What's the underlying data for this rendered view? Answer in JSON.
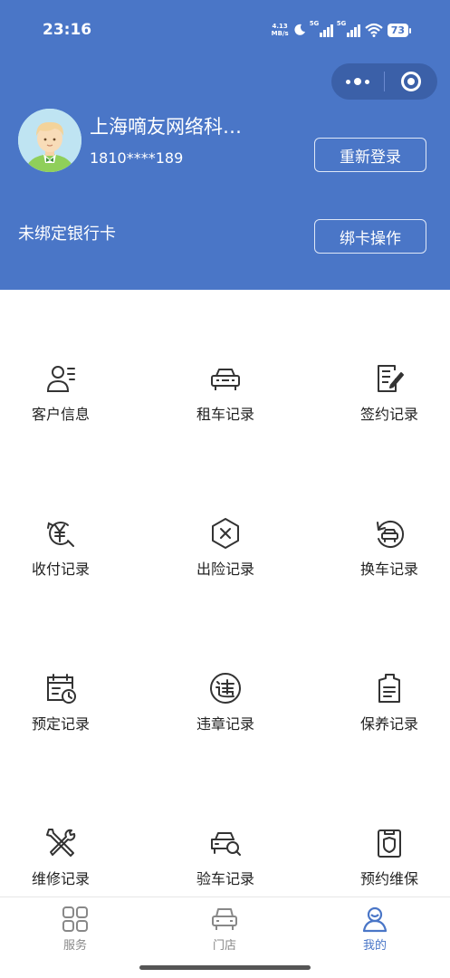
{
  "status_bar": {
    "time": "23:16",
    "net_speed_value": "4.13",
    "net_speed_unit": "MB/s",
    "signal_1": "5G",
    "signal_2": "5G",
    "battery": "73"
  },
  "capsule_icons": [
    "more-dots-icon",
    "close-target-icon"
  ],
  "profile": {
    "name": "上海嘀友网络科…",
    "phone": "1810****189",
    "relogin_label": "重新登录",
    "bank_status": "未绑定银行卡",
    "bind_card_label": "绑卡操作"
  },
  "menu": [
    {
      "label": "客户信息",
      "icon": "customer-info-icon"
    },
    {
      "label": "租车记录",
      "icon": "rental-car-icon"
    },
    {
      "label": "签约记录",
      "icon": "contract-icon"
    },
    {
      "label": "收付记录",
      "icon": "payment-icon"
    },
    {
      "label": "出险记录",
      "icon": "accident-icon"
    },
    {
      "label": "换车记录",
      "icon": "car-swap-icon"
    },
    {
      "label": "预定记录",
      "icon": "calendar-icon"
    },
    {
      "label": "违章记录",
      "icon": "violation-icon"
    },
    {
      "label": "保养记录",
      "icon": "maintenance-doc-icon"
    },
    {
      "label": "维修记录",
      "icon": "repair-tools-icon"
    },
    {
      "label": "验车记录",
      "icon": "car-inspect-icon"
    },
    {
      "label": "预约维保",
      "icon": "appointment-icon"
    }
  ],
  "tabbar": {
    "tabs": [
      {
        "label": "服务",
        "icon": "grid-icon"
      },
      {
        "label": "门店",
        "icon": "store-car-icon"
      },
      {
        "label": "我的",
        "icon": "user-icon"
      }
    ],
    "active": "我的",
    "active_color": "#4a76c7",
    "inactive_color": "#888888"
  },
  "colors": {
    "header_bg": "#4a76c7",
    "capsule_bg": "#3b60a8"
  }
}
